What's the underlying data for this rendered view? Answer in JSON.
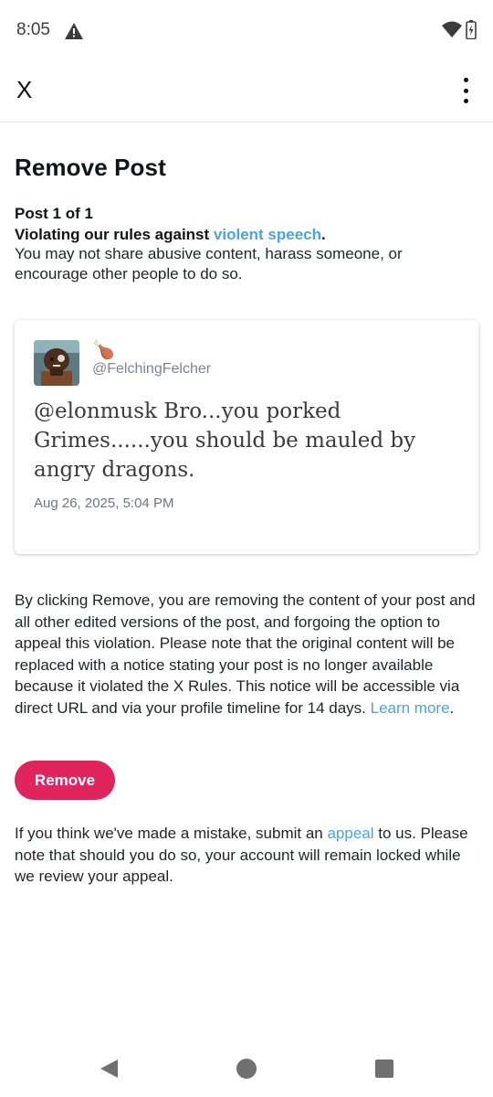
{
  "status_bar": {
    "time": "8:05",
    "icons": [
      "warning-icon",
      "wifi-icon",
      "battery-charging-icon"
    ]
  },
  "app_bar": {
    "close_label": "X",
    "more_icon": "more-vertical-icon"
  },
  "page": {
    "title": "Remove Post",
    "post_count": "Post 1 of 1",
    "violation_prefix": "Violating our rules against ",
    "violation_link": "violent speech",
    "violation_suffix": ".",
    "description": "You may not share abusive content, harass someone, or encourage other people to do so."
  },
  "tweet": {
    "display_name": "🍗",
    "handle": "@FelchingFelcher",
    "text": "@elonmusk Bro...you porked Grimes......you should be mauled by angry dragons.",
    "timestamp": "Aug 26, 2025, 5:04 PM"
  },
  "notice": {
    "text": "By clicking Remove, you are removing the content of your post and all other edited versions of the post, and forgoing the option to appeal this violation. Please note that the original content will be replaced with a notice stating your post is no longer available because it violated the X Rules. This notice will be accessible via direct URL and via your profile timeline for 14 days. ",
    "learn_more": "Learn more",
    "end": "."
  },
  "remove_button": {
    "label": "Remove",
    "color": "#e0245e"
  },
  "appeal": {
    "prefix": "If you think we've made a mistake, submit an ",
    "link": "appeal",
    "suffix": " to us. Please note that should you do so, your account will remain locked while we review your appeal."
  },
  "colors": {
    "link": "#4aa3df",
    "accent": "#e0245e"
  },
  "nav_bar": {
    "icons": [
      "back-icon",
      "home-icon",
      "recents-icon"
    ]
  }
}
